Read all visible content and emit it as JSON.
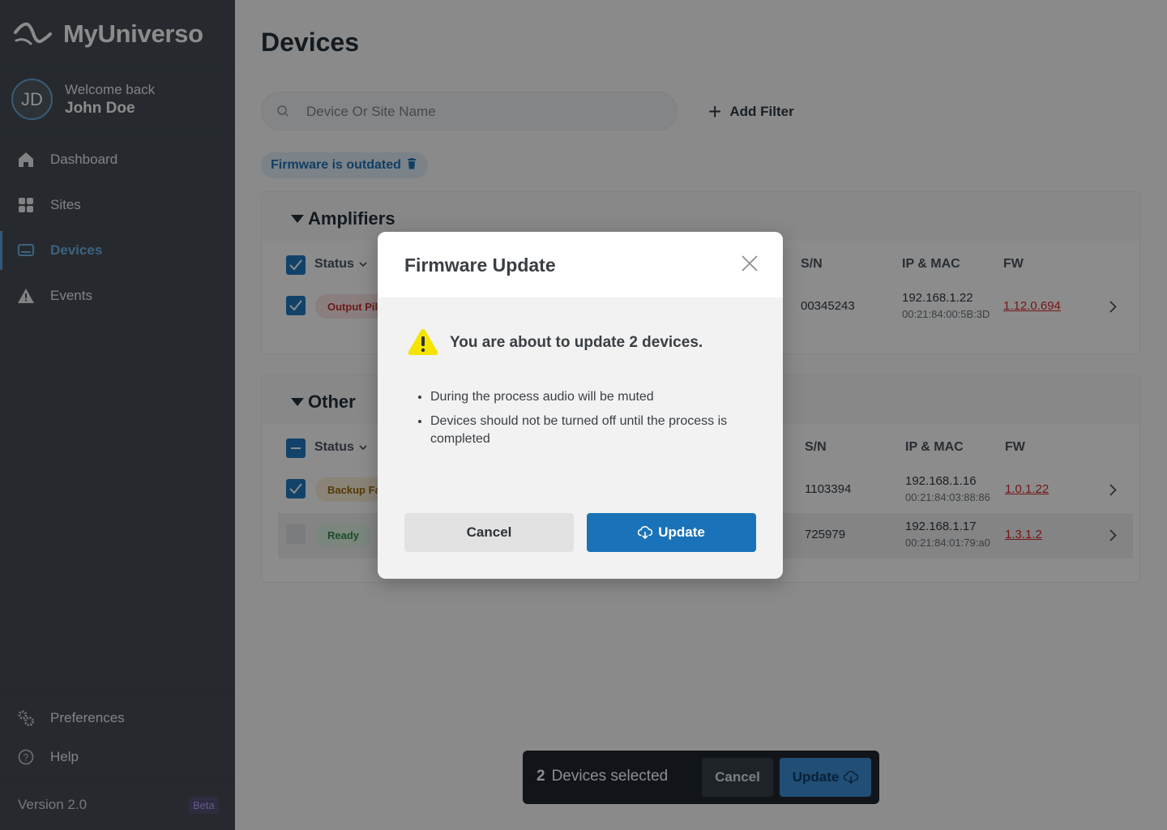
{
  "brand": {
    "name": "MyUniverso"
  },
  "user": {
    "initials": "JD",
    "greeting": "Welcome back",
    "name": "John Doe"
  },
  "nav": {
    "items": [
      {
        "label": "Dashboard",
        "icon": "home-icon"
      },
      {
        "label": "Sites",
        "icon": "grid-icon"
      },
      {
        "label": "Devices",
        "icon": "devices-icon",
        "active": true
      },
      {
        "label": "Events",
        "icon": "warning-icon"
      }
    ],
    "bottom": [
      {
        "label": "Preferences",
        "icon": "gears-icon"
      },
      {
        "label": "Help",
        "icon": "help-icon"
      }
    ],
    "version": "Version 2.0",
    "badge": "Beta"
  },
  "page": {
    "title": "Devices",
    "search_placeholder": "Device Or Site Name",
    "add_filter": "Add Filter",
    "active_filter": "Firmware is outdated"
  },
  "groups": [
    {
      "name": "Amplifiers",
      "columns": {
        "status": "Status",
        "sn": "S/N",
        "ip": "IP & MAC",
        "fw": "FW"
      },
      "rows": [
        {
          "status": "Output Pil",
          "sn": "00345243",
          "ip": "192.168.1.22",
          "mac": "00:21:84:00:5B:3D",
          "fw": "1.12.0.694"
        }
      ]
    },
    {
      "name": "Other",
      "columns": {
        "status": "Status",
        "sn": "S/N",
        "ip": "IP & MAC",
        "fw": "FW"
      },
      "rows": [
        {
          "status": "Backup Fa",
          "sn": "1103394",
          "ip": "192.168.1.16",
          "mac": "00:21:84:03:88:86",
          "fw": "1.0.1.22"
        },
        {
          "status": "Ready",
          "sn": "725979",
          "ip": "192.168.1.17",
          "mac": "00:21:84:01:79:a0",
          "fw": "1.3.1.2"
        }
      ]
    }
  ],
  "selection_bar": {
    "count": "2",
    "label": "Devices selected",
    "cancel": "Cancel",
    "update": "Update"
  },
  "modal": {
    "title": "Firmware Update",
    "warning": "You are about to update 2 devices.",
    "bullets": [
      "During the process audio will be muted",
      "Devices should not be turned off until the process is completed"
    ],
    "cancel": "Cancel",
    "update": "Update"
  },
  "colors": {
    "accent": "#1a73b8",
    "sidebar": "#454d55",
    "warning": "#f5e400",
    "danger": "#d42b2b"
  }
}
